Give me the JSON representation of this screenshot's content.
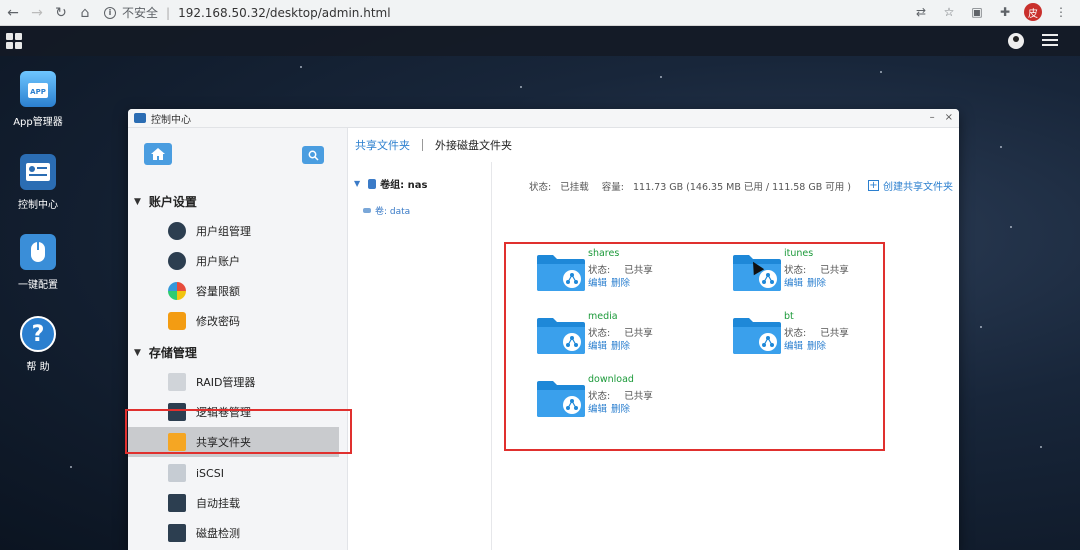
{
  "browser": {
    "insecure_label": "不安全",
    "separator": "|",
    "url": "192.168.50.32/desktop/admin.html",
    "profile_char": "皮"
  },
  "desktop": {
    "icons": [
      {
        "label": "App管理器",
        "icon": "app-store-icon"
      },
      {
        "label": "控制中心",
        "icon": "control-center-icon"
      },
      {
        "label": "一键配置",
        "icon": "one-click-config-icon"
      },
      {
        "label": "帮 助",
        "icon": "help-icon"
      }
    ]
  },
  "window": {
    "title": "控制中心",
    "minimize": "–",
    "close": "×"
  },
  "sidebar": {
    "sections": [
      {
        "label": "账户设置",
        "items": [
          "用户组管理",
          "用户账户",
          "容量限额",
          "修改密码"
        ]
      },
      {
        "label": "存储管理",
        "items": [
          "RAID管理器",
          "逻辑卷管理",
          "共享文件夹",
          "iSCSI",
          "自动挂载",
          "磁盘检测"
        ]
      }
    ],
    "active_item": "共享文件夹"
  },
  "tabs": [
    {
      "label": "共享文件夹",
      "active": true
    },
    {
      "label": "外接磁盘文件夹",
      "active": false
    }
  ],
  "tree": {
    "volume_group": "卷组: nas",
    "volume": "卷: data"
  },
  "status": {
    "state_label": "状态:",
    "state_value": "已挂载",
    "capacity_label": "容量:",
    "capacity_value": "111.73 GB (146.35 MB 已用 / 111.58 GB 可用 )"
  },
  "create_button": "创建共享文件夹",
  "folders": [
    {
      "name": "shares",
      "status_label": "状态:",
      "status_value": "已共享",
      "edit": "编辑",
      "delete": "删除"
    },
    {
      "name": "itunes",
      "status_label": "状态:",
      "status_value": "已共享",
      "edit": "编辑",
      "delete": "删除"
    },
    {
      "name": "media",
      "status_label": "状态:",
      "status_value": "已共享",
      "edit": "编辑",
      "delete": "删除"
    },
    {
      "name": "bt",
      "status_label": "状态:",
      "status_value": "已共享",
      "edit": "编辑",
      "delete": "删除"
    },
    {
      "name": "download",
      "status_label": "状态:",
      "status_value": "已共享",
      "edit": "编辑",
      "delete": "删除"
    }
  ],
  "colors": {
    "accent": "#2b7fcf",
    "folder_name": "#1c9a3a",
    "highlight": "#e0302e"
  }
}
